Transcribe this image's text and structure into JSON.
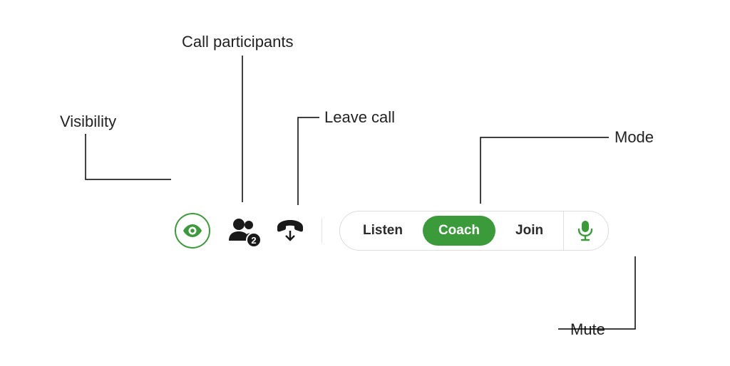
{
  "annotations": {
    "visibility": "Visibility",
    "participants": "Call participants",
    "leave": "Leave call",
    "mode": "Mode",
    "mute": "Mute"
  },
  "toolbar": {
    "participants_count": "2",
    "modes": {
      "listen": "Listen",
      "coach": "Coach",
      "join": "Join"
    },
    "active_mode": "coach"
  },
  "colors": {
    "accent": "#3b9b3b",
    "ink": "#1a1a1a"
  }
}
